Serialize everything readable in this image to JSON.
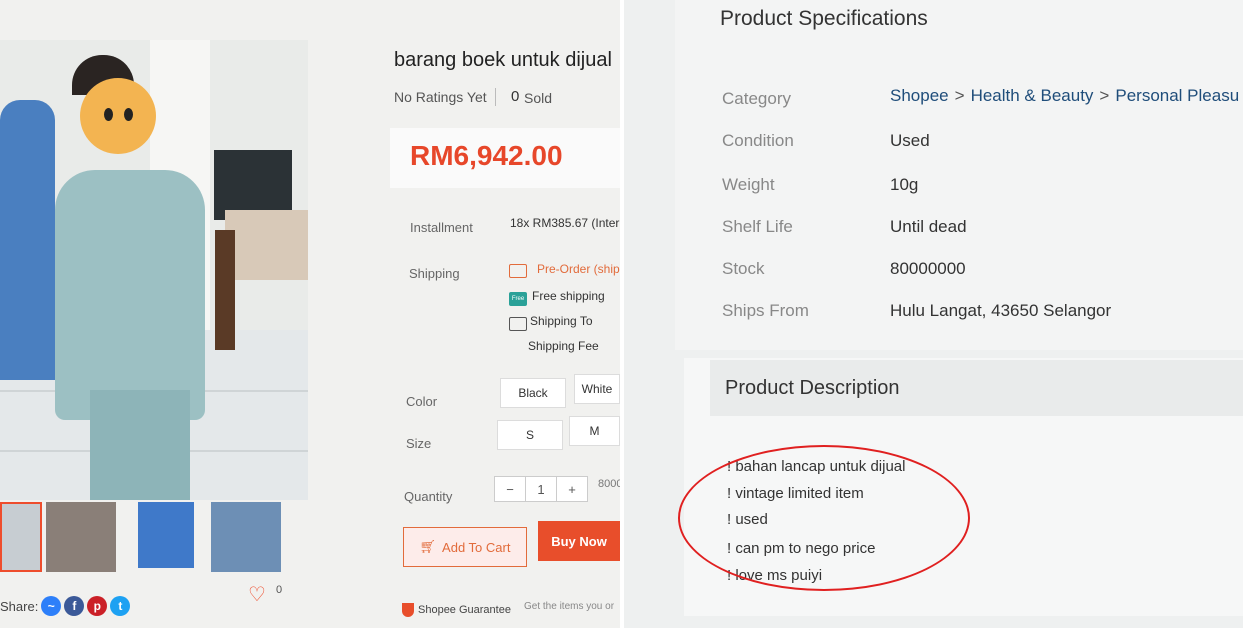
{
  "product": {
    "title": "barang boek untuk dijual",
    "ratings_label": "No Ratings Yet",
    "sold_count": "0",
    "sold_label": "Sold",
    "price": "RM6,942.00"
  },
  "details": {
    "installment_label": "Installment",
    "installment_value": "18x RM385.67 (Inter",
    "shipping_label": "Shipping",
    "preorder_text": "Pre-Order (ships",
    "free_shipping_text": "Free shipping",
    "free_badge": "Free",
    "shipping_to_text": "Shipping To",
    "shipping_fee_text": "Shipping Fee",
    "color_label": "Color",
    "color_options": [
      "Black",
      "White"
    ],
    "size_label": "Size",
    "size_options": [
      "S",
      "M"
    ],
    "quantity_label": "Quantity",
    "quantity_minus": "−",
    "quantity_value": "1",
    "quantity_plus": "+",
    "quantity_available": "8000"
  },
  "actions": {
    "add_to_cart": "Add To Cart",
    "buy_now": "Buy Now",
    "guarantee": "Shopee Guarantee",
    "guarantee_note": "Get the items you or"
  },
  "share": {
    "label": "Share:",
    "icons": [
      "messenger-icon",
      "facebook-icon",
      "pinterest-icon",
      "twitter-icon"
    ],
    "likes": "0"
  },
  "specifications": {
    "title": "Product Specifications",
    "category_label": "Category",
    "breadcrumb": [
      "Shopee",
      "Health & Beauty",
      "Personal Pleasu"
    ],
    "breadcrumb_sep": ">",
    "rows": [
      {
        "label": "Condition",
        "value": "Used"
      },
      {
        "label": "Weight",
        "value": "10g"
      },
      {
        "label": "Shelf Life",
        "value": "Until dead"
      },
      {
        "label": "Stock",
        "value": "80000000"
      },
      {
        "label": "Ships From",
        "value": "Hulu Langat, 43650 Selangor"
      }
    ]
  },
  "description": {
    "title": "Product Description",
    "lines": [
      "! bahan lancap untuk dijual",
      "! vintage limited item",
      "! used",
      "! can pm to nego price",
      "! love ms puiyi"
    ]
  },
  "colors": {
    "accent": "#ee4d2d",
    "price": "#e7472a",
    "link": "#1f4d7a",
    "highlight_circle": "#e02020"
  }
}
